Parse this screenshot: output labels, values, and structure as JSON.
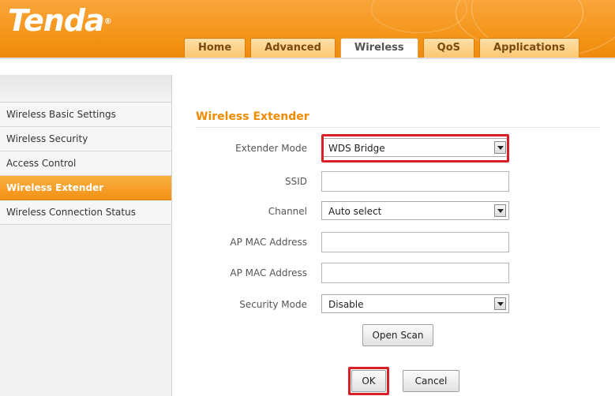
{
  "brand": {
    "logo": "Tenda",
    "reg": "®"
  },
  "nav": {
    "tabs": [
      {
        "label": "Home"
      },
      {
        "label": "Advanced"
      },
      {
        "label": "Wireless"
      },
      {
        "label": "QoS"
      },
      {
        "label": "Applications"
      }
    ],
    "active_tab": "Wireless"
  },
  "sidebar": {
    "items": [
      {
        "label": "Wireless Basic Settings"
      },
      {
        "label": "Wireless Security"
      },
      {
        "label": "Access Control"
      },
      {
        "label": "Wireless Extender"
      },
      {
        "label": "Wireless Connection Status"
      }
    ],
    "active_item": "Wireless Extender"
  },
  "main": {
    "section_title": "Wireless Extender",
    "fields": {
      "extender_mode": {
        "label": "Extender Mode",
        "value": "WDS Bridge"
      },
      "ssid": {
        "label": "SSID",
        "value": ""
      },
      "channel": {
        "label": "Channel",
        "value": "Auto select"
      },
      "ap_mac_1": {
        "label": "AP MAC Address",
        "value": ""
      },
      "ap_mac_2": {
        "label": "AP MAC Address",
        "value": ""
      },
      "security_mode": {
        "label": "Security Mode",
        "value": "Disable"
      }
    },
    "buttons": {
      "open_scan": "Open Scan",
      "ok": "OK",
      "cancel": "Cancel"
    }
  },
  "colors": {
    "brand_orange": "#f39314",
    "title_orange": "#f08a00",
    "highlight_red": "#d81f26"
  }
}
